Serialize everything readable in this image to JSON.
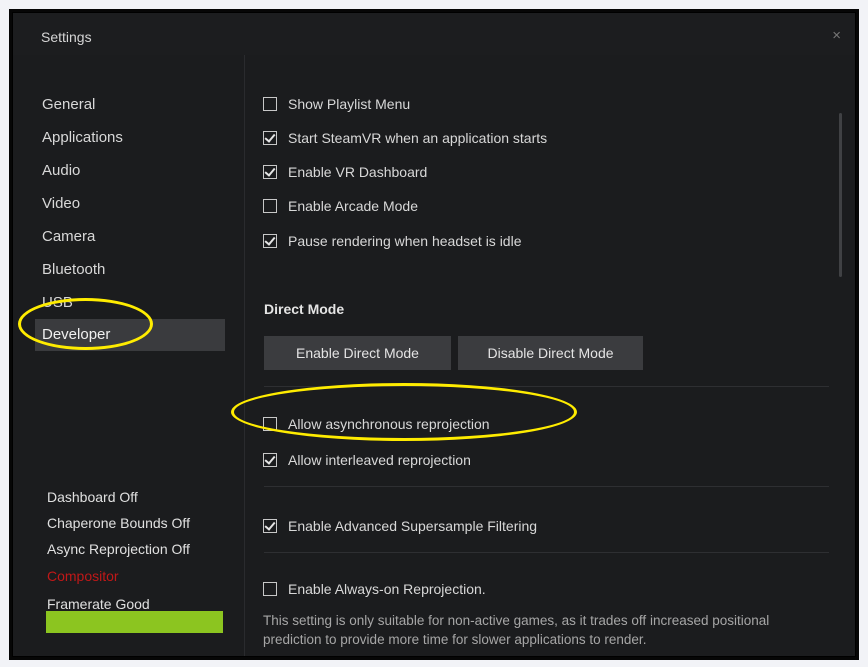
{
  "window": {
    "title": "Settings",
    "close_glyph": "×"
  },
  "sidebar": {
    "items": [
      {
        "label": "General"
      },
      {
        "label": "Applications"
      },
      {
        "label": "Audio"
      },
      {
        "label": "Video"
      },
      {
        "label": "Camera"
      },
      {
        "label": "Bluetooth"
      },
      {
        "label": "USB"
      },
      {
        "label": "Developer",
        "active": true
      }
    ],
    "status": [
      {
        "label": "Dashboard Off"
      },
      {
        "label": "Chaperone Bounds Off"
      },
      {
        "label": "Async Reprojection Off"
      },
      {
        "label": "Compositor",
        "color": "#c01818"
      },
      {
        "label": "Framerate Good"
      }
    ],
    "perf_bar_color": "#8cc520"
  },
  "main": {
    "options": [
      {
        "label": "Show Playlist Menu",
        "checked": false
      },
      {
        "label": "Start SteamVR when an application starts",
        "checked": true
      },
      {
        "label": "Enable VR Dashboard",
        "checked": true
      },
      {
        "label": "Enable Arcade Mode",
        "checked": false
      },
      {
        "label": "Pause rendering when headset is idle",
        "checked": true
      }
    ],
    "direct_mode": {
      "title": "Direct Mode",
      "enable_label": "Enable Direct Mode",
      "disable_label": "Disable Direct Mode"
    },
    "reprojection": [
      {
        "label": "Allow asynchronous reprojection",
        "checked": false
      },
      {
        "label": "Allow interleaved reprojection",
        "checked": true
      }
    ],
    "supersample": {
      "label": "Enable Advanced Supersample Filtering",
      "checked": true
    },
    "always_on": {
      "label": "Enable Always-on Reprojection.",
      "checked": false,
      "description": "This setting is only suitable for non-active games, as it trades off increased positional prediction to provide more time for slower applications to render."
    }
  },
  "highlight_color": "#ffec00"
}
